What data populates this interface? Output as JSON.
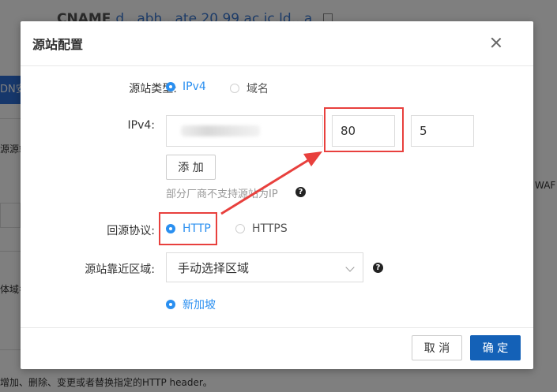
{
  "background": {
    "title_prefix": "CNAME",
    "title_value": "d...abh...ate.20.99.ac.ic.ld...a",
    "tab_label": "DN安",
    "left_label_1": "源源站",
    "right_label": "WAF",
    "left_label_2": "体域名",
    "footer_text": "增加、删除、变更或者替换指定的HTTP header。"
  },
  "modal": {
    "title": "源站配置",
    "origin_type": {
      "label": "源站类型:",
      "options": [
        "IPv4",
        "域名"
      ],
      "selected": "IPv4"
    },
    "ipv4": {
      "label": "IPv4:",
      "port_value": "80",
      "weight_value": "5",
      "add_button": "添 加",
      "hint": "部分厂商不支持源站为IP"
    },
    "protocol": {
      "label": "回源协议:",
      "options": [
        "HTTP",
        "HTTPS"
      ],
      "selected": "HTTP"
    },
    "region": {
      "label": "源站靠近区域:",
      "select_value": "手动选择区域",
      "option_selected": "新加坡"
    },
    "footer": {
      "cancel": "取 消",
      "confirm": "确 定"
    }
  },
  "colors": {
    "accent": "#2a8ff0",
    "primary_button": "#1461b7",
    "annotation_red": "#e8403d"
  }
}
